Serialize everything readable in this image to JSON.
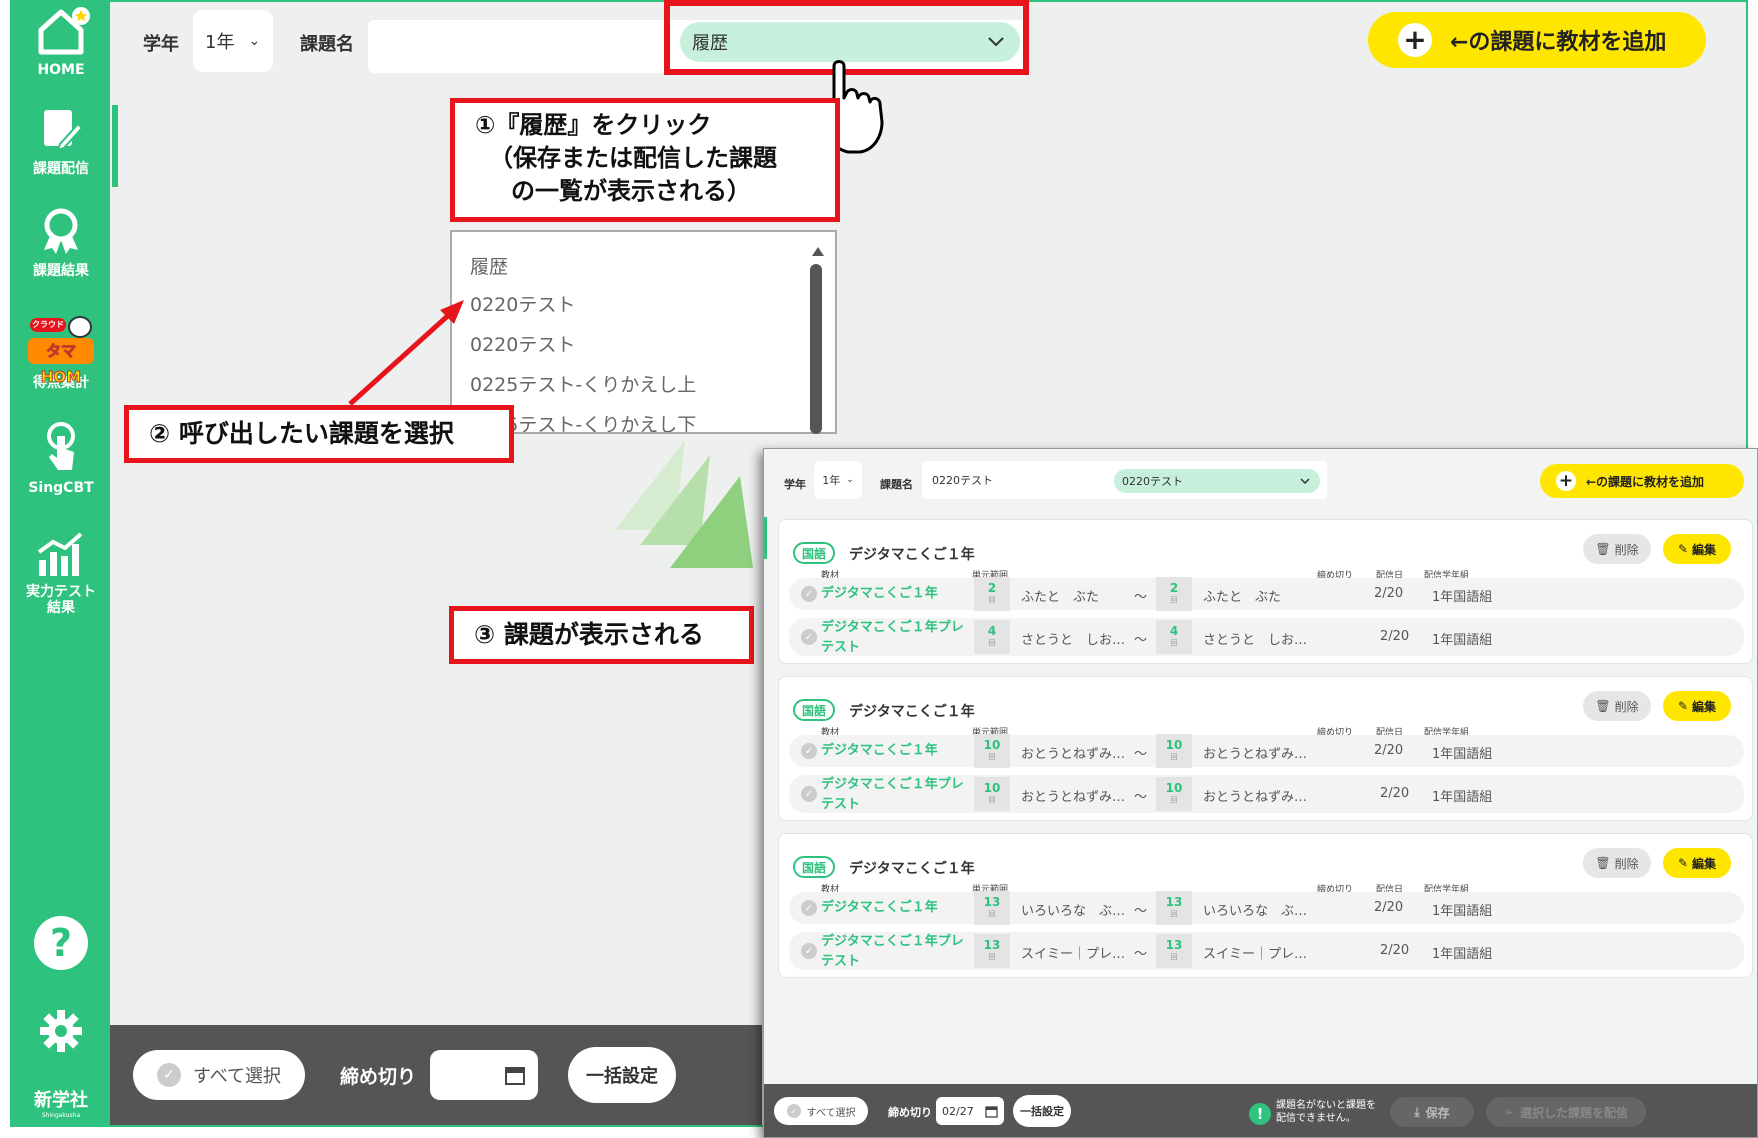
{
  "sidebar": {
    "items": [
      {
        "label": "HOME",
        "icon": "home-icon"
      },
      {
        "label": "課題配信",
        "icon": "notepad-icon"
      },
      {
        "label": "課題結果",
        "icon": "ribbon-icon"
      },
      {
        "label": "得点集計",
        "icon": "tamahome-logo",
        "logo_text": "タマHOM",
        "logo_small": "クラウド"
      },
      {
        "label": "SingCBT",
        "icon": "touch-icon"
      },
      {
        "label": "実力テスト結果",
        "icon": "bar-chart-icon"
      }
    ],
    "help": "?",
    "brand": "新学社",
    "brand_sub": "Shingakusha"
  },
  "topbar": {
    "grade_label": "学年",
    "grade_value": "1年",
    "taskname_label": "課題名",
    "history_value": "履歴",
    "add_button": "←の課題に教材を追加"
  },
  "dropdown": {
    "items": [
      "履歴",
      "0220テスト",
      "0220テスト",
      "0225テスト-くりかえし上",
      "0225テスト-くりかえし下"
    ]
  },
  "callouts": {
    "step1_line1": "①『履歴』をクリック",
    "step1_line2": "（保存または配信した課題",
    "step1_line3": "の一覧が表示される）",
    "step2": "② 呼び出したい課題を選択",
    "step3": "③ 課題が表示される"
  },
  "bottombar": {
    "select_all": "すべて選択",
    "deadline_label": "締め切り",
    "bulk_set": "一括設定"
  },
  "screen2": {
    "grade_label": "学年",
    "grade_value": "1年",
    "taskname_label": "課題名",
    "taskname_value": "0220テスト",
    "history_value": "0220テスト",
    "add_button": "←の課題に教材を追加",
    "headers": {
      "material": "教材",
      "range": "単元範囲",
      "deadline": "締め切り",
      "date": "配信日",
      "class": "配信学年組"
    },
    "delete": "削除",
    "edit": "編集",
    "cards": [
      {
        "tag": "国語",
        "title": "デジタマこくご１年",
        "rows": [
          {
            "material": "デジタマこくご１年",
            "from_no": "2",
            "from_text": "ふたと　ぶた",
            "to_no": "2",
            "to_text": "ふたと　ぶた",
            "date": "2/20",
            "class": "1年国語組"
          },
          {
            "material": "デジタマこくご１年プレテスト",
            "from_no": "4",
            "from_text": "さとうと　しお…",
            "to_no": "4",
            "to_text": "さとうと　しお…",
            "date": "2/20",
            "class": "1年国語組"
          }
        ]
      },
      {
        "tag": "国語",
        "title": "デジタマこくご１年",
        "rows": [
          {
            "material": "デジタマこくご１年",
            "from_no": "10",
            "from_text": "おとうとねずみ…",
            "to_no": "10",
            "to_text": "おとうとねずみ…",
            "date": "2/20",
            "class": "1年国語組"
          },
          {
            "material": "デジタマこくご１年プレテスト",
            "from_no": "10",
            "from_text": "おとうとねずみ…",
            "to_no": "10",
            "to_text": "おとうとねずみ…",
            "date": "2/20",
            "class": "1年国語組"
          }
        ]
      },
      {
        "tag": "国語",
        "title": "デジタマこくご１年",
        "rows": [
          {
            "material": "デジタマこくご１年",
            "from_no": "13",
            "from_text": "いろいろな　ぶ…",
            "to_no": "13",
            "to_text": "いろいろな　ぶ…",
            "date": "2/20",
            "class": "1年国語組"
          },
          {
            "material": "デジタマこくご１年プレテスト",
            "from_no": "13",
            "from_text": "スイミー｜プレ…",
            "to_no": "13",
            "to_text": "スイミー｜プレ…",
            "date": "2/20",
            "class": "1年国語組"
          }
        ]
      }
    ],
    "unit_small": "回",
    "tilde": "〜",
    "bottom": {
      "select_all": "すべて選択",
      "deadline_label": "締め切り",
      "deadline_value": "02/27",
      "bulk_set": "一括設定",
      "warning": "課題名がないと課題を配信できません。",
      "save": "保存",
      "send": "選択した課題を配信"
    }
  },
  "colors": {
    "green": "#2ec27e",
    "yellow": "#ffe600",
    "red": "#e8141b",
    "history_bg": "#c6f0dc"
  }
}
